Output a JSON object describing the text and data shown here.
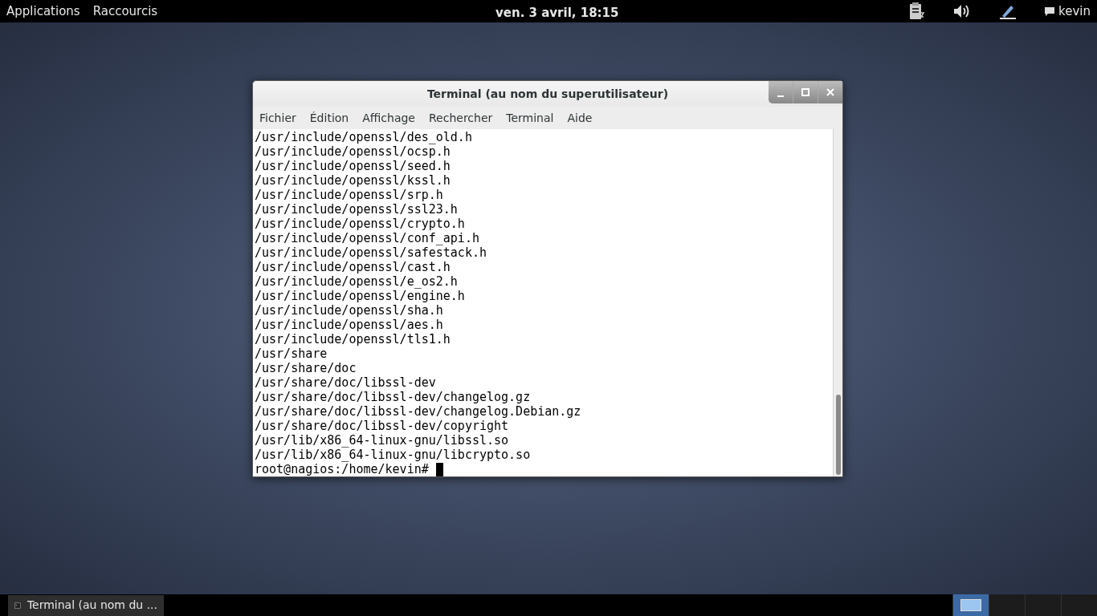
{
  "top_bar": {
    "menus": [
      "Applications",
      "Raccourcis"
    ],
    "clock": "ven.  3 avril, 18:15",
    "user": "kevin"
  },
  "window": {
    "title": "Terminal (au nom du superutilisateur)",
    "menu": [
      "Fichier",
      "Édition",
      "Affichage",
      "Rechercher",
      "Terminal",
      "Aide"
    ],
    "lines": [
      "/usr/include/openssl/des_old.h",
      "/usr/include/openssl/ocsp.h",
      "/usr/include/openssl/seed.h",
      "/usr/include/openssl/kssl.h",
      "/usr/include/openssl/srp.h",
      "/usr/include/openssl/ssl23.h",
      "/usr/include/openssl/crypto.h",
      "/usr/include/openssl/conf_api.h",
      "/usr/include/openssl/safestack.h",
      "/usr/include/openssl/cast.h",
      "/usr/include/openssl/e_os2.h",
      "/usr/include/openssl/engine.h",
      "/usr/include/openssl/sha.h",
      "/usr/include/openssl/aes.h",
      "/usr/include/openssl/tls1.h",
      "/usr/share",
      "/usr/share/doc",
      "/usr/share/doc/libssl-dev",
      "/usr/share/doc/libssl-dev/changelog.gz",
      "/usr/share/doc/libssl-dev/changelog.Debian.gz",
      "/usr/share/doc/libssl-dev/copyright",
      "/usr/lib/x86_64-linux-gnu/libssl.so",
      "/usr/lib/x86_64-linux-gnu/libcrypto.so"
    ],
    "prompt": "root@nagios:/home/kevin# "
  },
  "taskbar": {
    "window_button": "Terminal (au nom du ...",
    "workspaces": [
      {
        "selected": true
      },
      {
        "selected": false
      },
      {
        "selected": false
      },
      {
        "selected": false
      }
    ]
  }
}
